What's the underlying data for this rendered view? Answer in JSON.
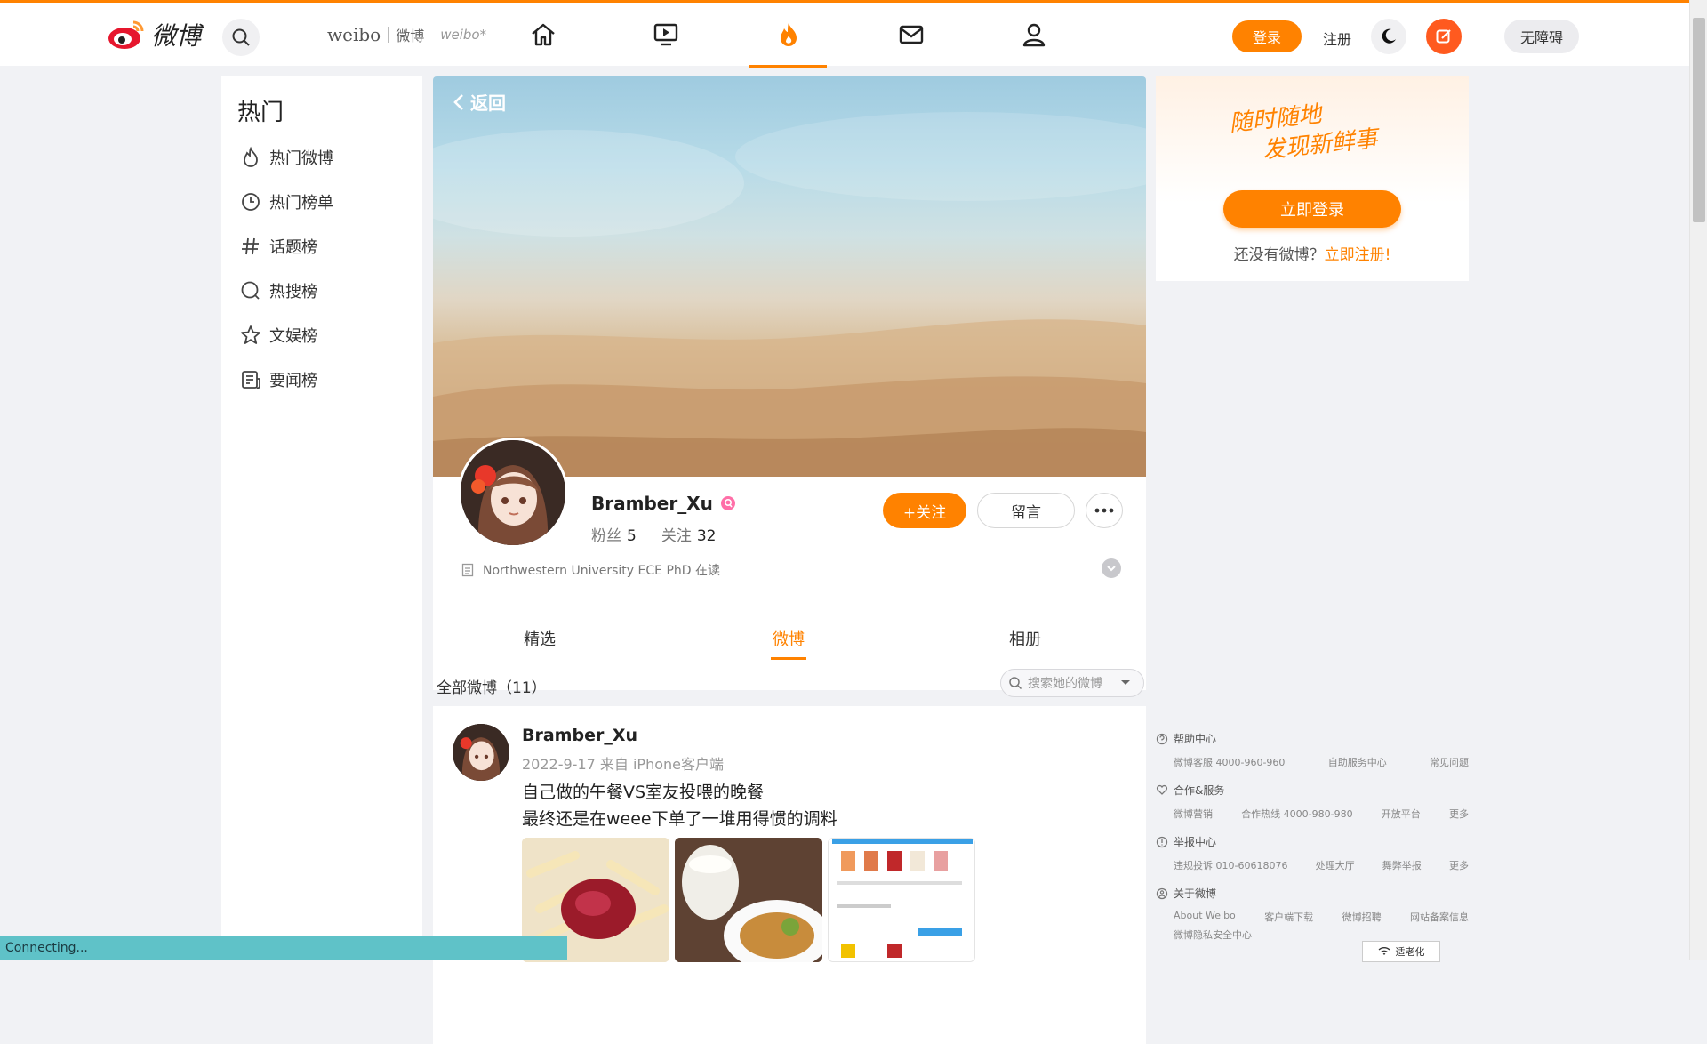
{
  "nav": {
    "logo_text": "微博",
    "brand_en": "weibo",
    "brand_cn": "微博",
    "brand_small": "weibo*",
    "login": "登录",
    "register": "注册",
    "accessibility": "无障碍"
  },
  "sidebar": {
    "title": "热门",
    "items": [
      {
        "label": "热门微博",
        "icon": "flame-icon"
      },
      {
        "label": "热门榜单",
        "icon": "clock-icon"
      },
      {
        "label": "话题榜",
        "icon": "hash-icon"
      },
      {
        "label": "热搜榜",
        "icon": "search-ring-icon"
      },
      {
        "label": "文娱榜",
        "icon": "star-icon"
      },
      {
        "label": "要闻榜",
        "icon": "news-icon"
      }
    ]
  },
  "profile": {
    "back": "返回",
    "name": "Bramber_Xu",
    "fans_label": "粉丝",
    "fans": "5",
    "follow_label": "关注",
    "follow": "32",
    "follow_button": "+关注",
    "message_button": "留言",
    "description": "Northwestern University ECE PhD 在读"
  },
  "tabs": [
    "精选",
    "微博",
    "相册"
  ],
  "feed": {
    "count_label": "全部微博（11）",
    "search_placeholder": "搜索她的微博"
  },
  "post": {
    "author": "Bramber_Xu",
    "meta": "2022-9-17  来自 iPhone客户端",
    "line1": "自己做的午餐VS室友投喂的晚餐",
    "line2": "最终还是在weee下单了一堆用得惯的调料"
  },
  "login_card": {
    "slogan_line1": "随时随地",
    "slogan_line2": "发现新鲜事",
    "button": "立即登录",
    "note": "还没有微博？",
    "register_link": "立即注册!"
  },
  "footer": {
    "help": {
      "title": "帮助中心",
      "links": [
        "微博客服 4000-960-960",
        "自助服务中心",
        "常见问题"
      ]
    },
    "coop": {
      "title": "合作&服务",
      "links": [
        "微博营销",
        "合作热线 4000-980-980",
        "开放平台",
        "更多"
      ]
    },
    "report": {
      "title": "举报中心",
      "links": [
        "违规投诉 010-60618076",
        "处理大厅",
        "舞弊举报",
        "更多"
      ]
    },
    "about": {
      "title": "关于微博",
      "links": [
        "About Weibo",
        "客户端下载",
        "微博招聘",
        "网站备案信息"
      ],
      "extra": "微博隐私安全中心"
    },
    "elder_mode": "适老化"
  },
  "status_bar": "Connecting...",
  "colors": {
    "accent": "#ff8200",
    "status": "#5fc2c8"
  }
}
